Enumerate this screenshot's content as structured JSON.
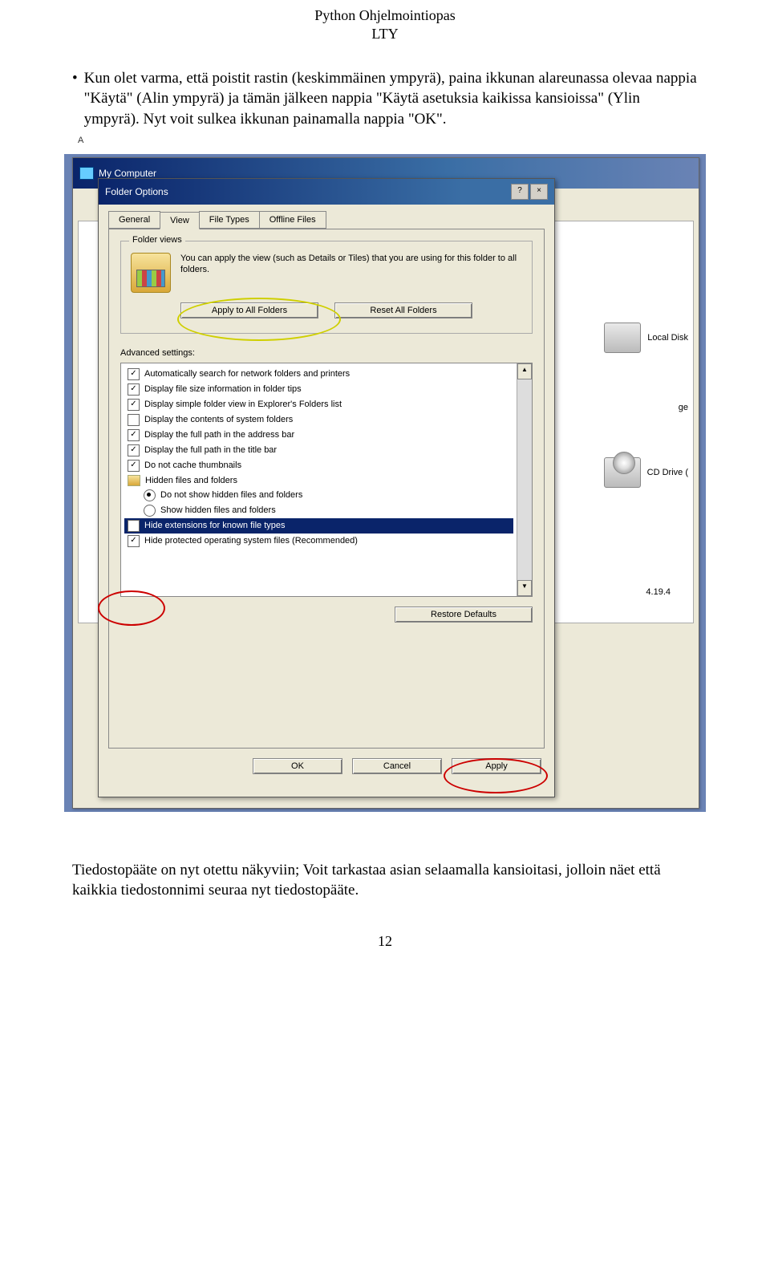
{
  "header": {
    "line1": "Python Ohjelmointiopas",
    "line2": "LTY"
  },
  "bullet_text": "Kun olet varma, että poistit rastin (keskimmäinen ympyrä), paina ikkunan alareunassa olevaa nappia \"Käytä\" (Alin ympyrä) ja tämän jälkeen nappia \"Käytä asetuksia kaikissa kansioissa\" (Ylin ympyrä). Nyt voit sulkea ikkunan painamalla nappia \"OK\".",
  "mycomputer": {
    "title": "My Computer",
    "addr_label": "A",
    "local_disk": "Local Disk",
    "cd_drive": "CD Drive (",
    "storage_label": "ge",
    "version": "4.19.4"
  },
  "dialog": {
    "title": "Folder Options",
    "help": "?",
    "close": "×",
    "tabs": {
      "general": "General",
      "view": "View",
      "file_types": "File Types",
      "offline": "Offline Files"
    },
    "folder_views": {
      "label": "Folder views",
      "desc": "You can apply the view (such as Details or Tiles) that you are using for this folder to all folders.",
      "apply_all": "Apply to All Folders",
      "reset_all": "Reset All Folders"
    },
    "advanced": {
      "label": "Advanced settings:",
      "items": [
        {
          "type": "check",
          "checked": true,
          "label": "Automatically search for network folders and printers"
        },
        {
          "type": "check",
          "checked": true,
          "label": "Display file size information in folder tips"
        },
        {
          "type": "check",
          "checked": true,
          "label": "Display simple folder view in Explorer's Folders list"
        },
        {
          "type": "check",
          "checked": false,
          "label": "Display the contents of system folders"
        },
        {
          "type": "check",
          "checked": true,
          "label": "Display the full path in the address bar"
        },
        {
          "type": "check",
          "checked": true,
          "label": "Display the full path in the title bar"
        },
        {
          "type": "check",
          "checked": true,
          "label": "Do not cache thumbnails"
        },
        {
          "type": "folder",
          "label": "Hidden files and folders"
        },
        {
          "type": "radio",
          "checked": true,
          "indent": true,
          "label": "Do not show hidden files and folders"
        },
        {
          "type": "radio",
          "checked": false,
          "indent": true,
          "label": "Show hidden files and folders"
        },
        {
          "type": "check",
          "checked": false,
          "selected": true,
          "label": "Hide extensions for known file types"
        },
        {
          "type": "check",
          "checked": true,
          "label": "Hide protected operating system files (Recommended)"
        }
      ],
      "restore": "Restore Defaults"
    },
    "buttons": {
      "ok": "OK",
      "cancel": "Cancel",
      "apply": "Apply"
    }
  },
  "after_text": "Tiedostopääte on nyt otettu näkyviin; Voit tarkastaa asian selaamalla kansioitasi, jolloin näet että kaikkia tiedostonnimi seuraa nyt tiedostopääte.",
  "page_number": "12"
}
